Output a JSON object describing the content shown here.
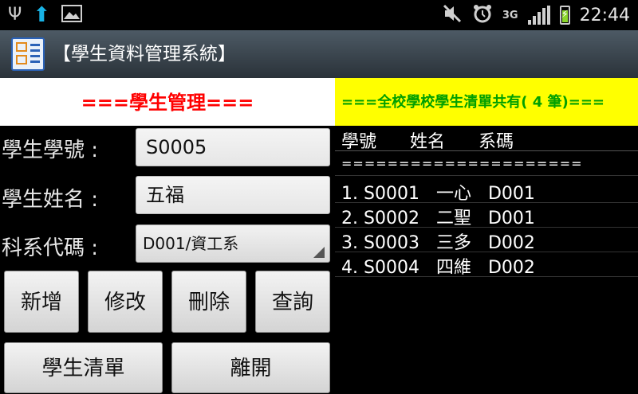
{
  "status_bar": {
    "icons": [
      "usb-icon",
      "upload-icon",
      "image-icon",
      "mute-icon",
      "alarm-icon",
      "signal-icon",
      "battery-charging-icon"
    ],
    "network": "3G",
    "time": "22:44"
  },
  "app": {
    "title": "【學生資料管理系統】",
    "icon": "app-icon"
  },
  "banner": {
    "left": "===學生管理===",
    "right": "===全校學校學生清單共有( 4 筆)===",
    "left_color": "#ff0000",
    "right_color": "#00a000",
    "right_bg": "#ffff00"
  },
  "form": {
    "student_id_label": "學生學號 :",
    "student_id_value": "S0005",
    "student_name_label": "學生姓名 :",
    "student_name_value": "五福",
    "dept_label": "科系代碼 :",
    "dept_value": "D001/資工系"
  },
  "buttons": {
    "add": "新增",
    "edit": "修改",
    "delete": "刪除",
    "query": "查詢",
    "list": "學生清單",
    "exit": "離開"
  },
  "list": {
    "header_id": "學號",
    "header_name": "姓名",
    "header_dept": "系碼",
    "separator": "=====================",
    "rows": [
      {
        "index": "1.",
        "id": "S0001",
        "name": "一心",
        "dept": "D001"
      },
      {
        "index": "2.",
        "id": "S0002",
        "name": "二聖",
        "dept": "D001"
      },
      {
        "index": "3.",
        "id": "S0003",
        "name": "三多",
        "dept": "D002"
      },
      {
        "index": "4.",
        "id": "S0004",
        "name": "四維",
        "dept": "D002"
      }
    ]
  }
}
